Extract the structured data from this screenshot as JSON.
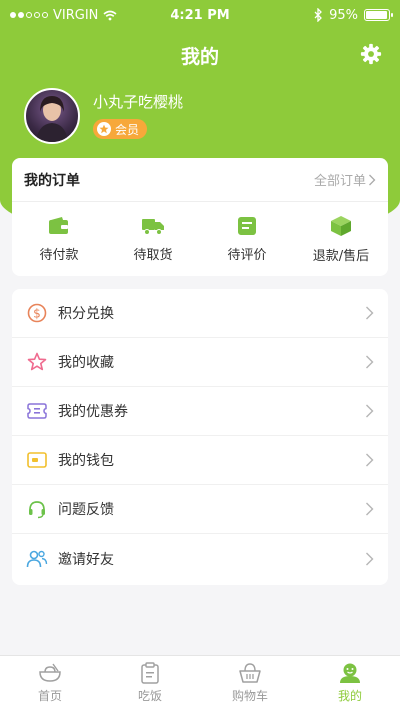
{
  "status": {
    "carrier": "VIRGIN",
    "time": "4:21 PM",
    "battery": "95%",
    "battery_level": 0.95
  },
  "header": {
    "title": "我的"
  },
  "profile": {
    "username": "小丸子吃樱桃",
    "badge": "会员"
  },
  "orders": {
    "title": "我的订单",
    "all_label": "全部订单",
    "items": [
      {
        "label": "待付款",
        "icon": "wallet-icon"
      },
      {
        "label": "待取货",
        "icon": "truck-icon"
      },
      {
        "label": "待评价",
        "icon": "review-icon"
      },
      {
        "label": "退款/售后",
        "icon": "box-icon"
      }
    ]
  },
  "menu": {
    "items": [
      {
        "label": "积分兑换",
        "icon": "coin-icon",
        "color": "#e8845a"
      },
      {
        "label": "我的收藏",
        "icon": "star-icon",
        "color": "#ef6b8f"
      },
      {
        "label": "我的优惠券",
        "icon": "coupon-icon",
        "color": "#8a74d9"
      },
      {
        "label": "我的钱包",
        "icon": "wallet-icon",
        "color": "#f2c02d"
      },
      {
        "label": "问题反馈",
        "icon": "headset-icon",
        "color": "#6cc24a"
      },
      {
        "label": "邀请好友",
        "icon": "users-icon",
        "color": "#4aa7e0"
      }
    ]
  },
  "tabs": [
    {
      "label": "首页",
      "icon": "bowl-icon"
    },
    {
      "label": "吃饭",
      "icon": "clipboard-icon"
    },
    {
      "label": "购物车",
      "icon": "basket-icon"
    },
    {
      "label": "我的",
      "icon": "user-icon",
      "active": true
    }
  ],
  "colors": {
    "accent": "#8ecb3a",
    "badge": "#f7a83a"
  }
}
